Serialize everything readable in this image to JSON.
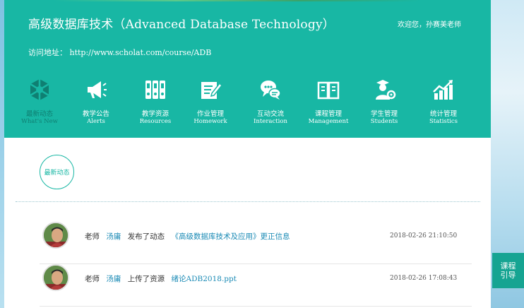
{
  "header": {
    "course_title": "高级数据库技术（Advanced Database Technology）",
    "welcome": "欢迎您，孙赛美老师",
    "url_label": "访问地址：",
    "url_value": "http://www.scholat.com/course/ADB"
  },
  "nav": [
    {
      "cn": "最新动态",
      "en": "What's New",
      "icon": "news-cube-icon",
      "active": true
    },
    {
      "cn": "教学公告",
      "en": "Alerts",
      "icon": "megaphone-icon"
    },
    {
      "cn": "教学资源",
      "en": "Resources",
      "icon": "binders-icon"
    },
    {
      "cn": "作业管理",
      "en": "Homework",
      "icon": "edit-document-icon"
    },
    {
      "cn": "互动交流",
      "en": "Interaction",
      "icon": "chat-bubbles-icon"
    },
    {
      "cn": "课程管理",
      "en": "Management",
      "icon": "open-book-icon"
    },
    {
      "cn": "学生管理",
      "en": "Students",
      "icon": "student-gear-icon"
    },
    {
      "cn": "统计管理",
      "en": "Statistics",
      "icon": "bar-chart-icon"
    }
  ],
  "section": {
    "label": "最新动态"
  },
  "feed": [
    {
      "role": "老师",
      "name": "汤庸",
      "action": "发布了动态",
      "target": "《高级数据库技术及应用》更正信息",
      "time": "2018-02-26 21:10:50"
    },
    {
      "role": "老师",
      "name": "汤庸",
      "action": "上传了资源",
      "target": "绪论ADB2018.ppt",
      "time": "2018-02-26 17:08:43"
    }
  ],
  "guide_tab": {
    "line1": "课程",
    "line2": "引导"
  },
  "colors": {
    "header": "#18b7a4",
    "link": "#1a8ab5",
    "tab": "#16a492"
  }
}
